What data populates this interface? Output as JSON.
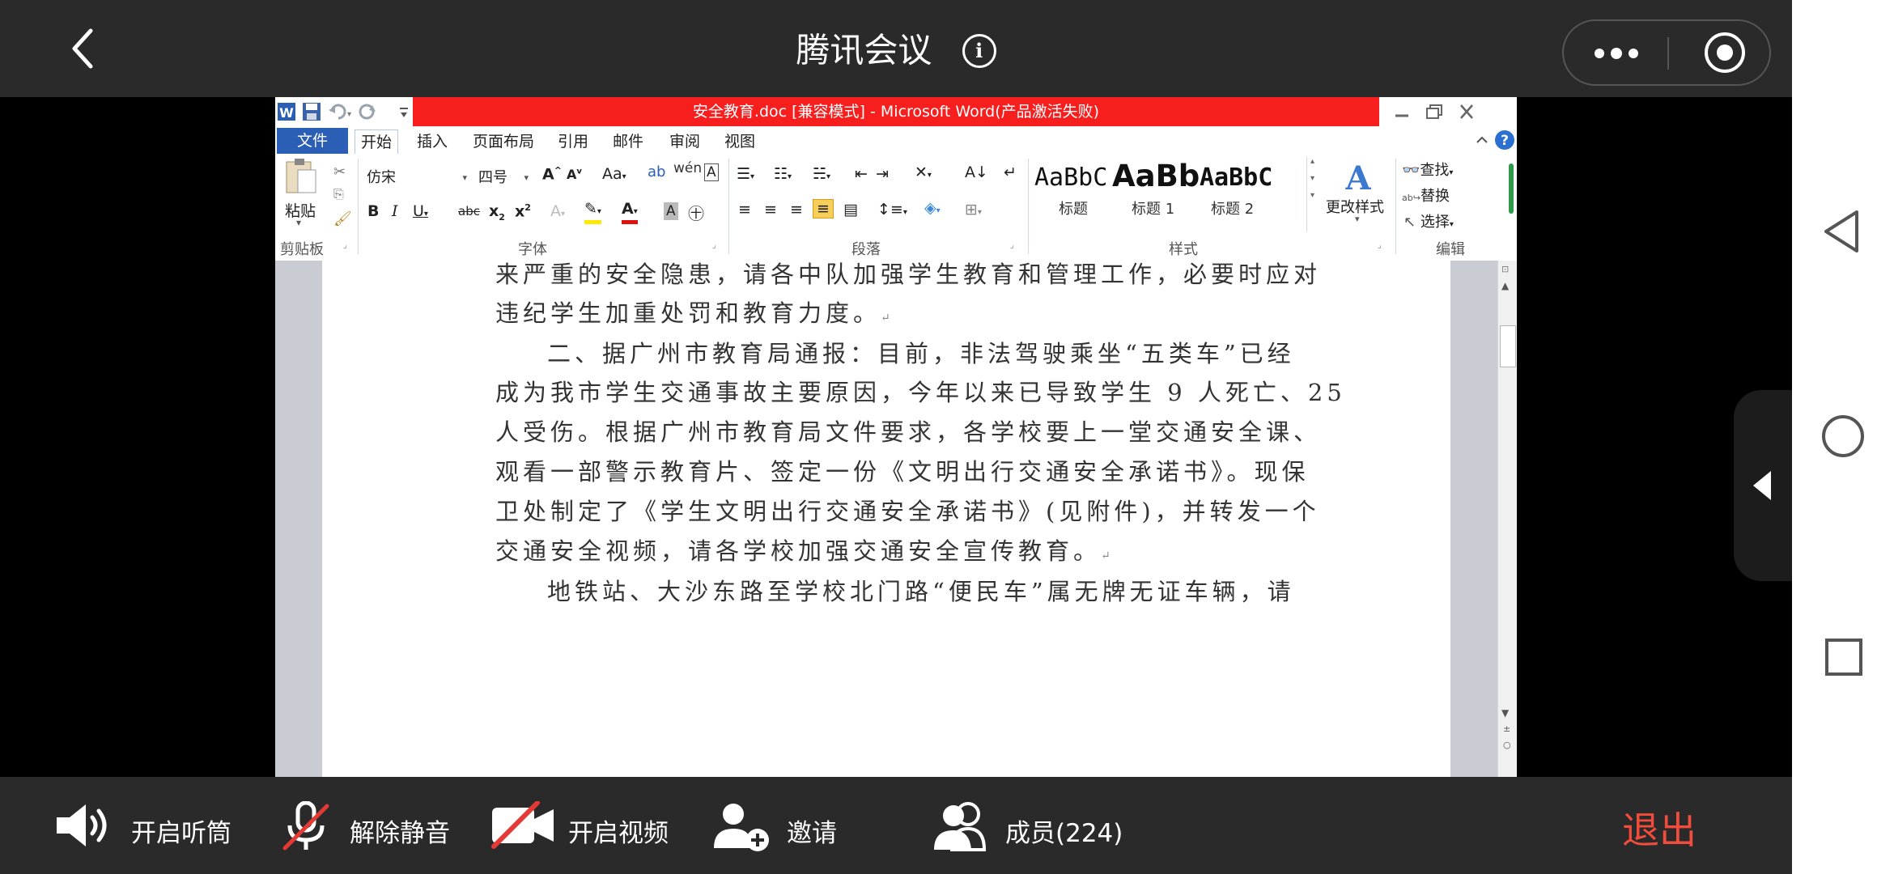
{
  "meeting": {
    "title": "腾讯会议"
  },
  "word": {
    "window_title": "安全教育.doc [兼容模式] - Microsoft Word(产品激活失败)",
    "tabs": [
      "文件",
      "开始",
      "插入",
      "页面布局",
      "引用",
      "邮件",
      "审阅",
      "视图"
    ],
    "ribbon": {
      "paste_label": "粘贴",
      "font_name": "仿宋",
      "font_size": "四号",
      "styles": [
        {
          "sample": "AaBbC",
          "name": "标题"
        },
        {
          "sample": "AaBb",
          "name": "标题 1"
        },
        {
          "sample": "AaBbC",
          "name": "标题 2"
        }
      ],
      "change_styles_label": "更改样式",
      "find_label": "查找",
      "replace_label": "替换",
      "select_label": "选择",
      "group_labels": {
        "clipboard": "剪贴板",
        "font": "字体",
        "paragraph": "段落",
        "styles": "样式",
        "editing": "编辑"
      }
    },
    "document_lines": [
      "来严重的安全隐患，请各中队加强学生教育和管理工作，必要时应对",
      "违纪学生加重处罚和教育力度。",
      "二、据广州市教育局通报：目前，非法驾驶乘坐“五类车”已经",
      "成为我市学生交通事故主要原因，今年以来已导致学生 9 人死亡、25",
      "人受伤。根据广州市教育局文件要求，各学校要上一堂交通安全课、",
      "观看一部警示教育片、签定一份《文明出行交通安全承诺书》。现保",
      "卫处制定了《学生文明出行交通安全承诺书》(见附件)，并转发一个",
      "交通安全视频，请各学校加强交通安全宣传教育。",
      "地铁站、大沙东路至学校北门路“便民车”属无牌无证车辆，请"
    ]
  },
  "controls": {
    "speaker": "开启听筒",
    "unmute": "解除静音",
    "video": "开启视频",
    "invite": "邀请",
    "members": "成员(224)",
    "exit": "退出"
  },
  "colors": {
    "title_bar_red": "#f71e1e",
    "exit_red": "#f24d3c",
    "file_tab_blue": "#2b5fb5",
    "mute_slash_red": "#e53935"
  }
}
